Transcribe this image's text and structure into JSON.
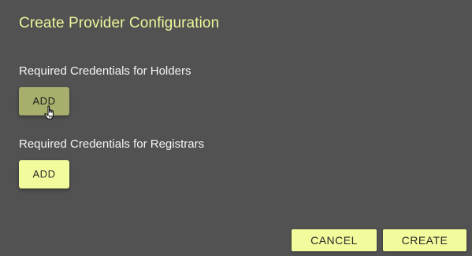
{
  "dialog": {
    "title": "Create Provider Configuration",
    "holders_label": "Required Credentials for Holders",
    "holders_add_label": "ADD",
    "registrars_label": "Required Credentials for Registrars",
    "registrars_add_label": "ADD",
    "cancel_label": "CANCEL",
    "create_label": "CREATE"
  },
  "colors": {
    "background": "#525252",
    "accent": "#f2fc9c",
    "title": "#eef59a",
    "hovered_button": "#a8ae6c"
  },
  "cursor": {
    "icon": "hand-pointer-icon"
  }
}
